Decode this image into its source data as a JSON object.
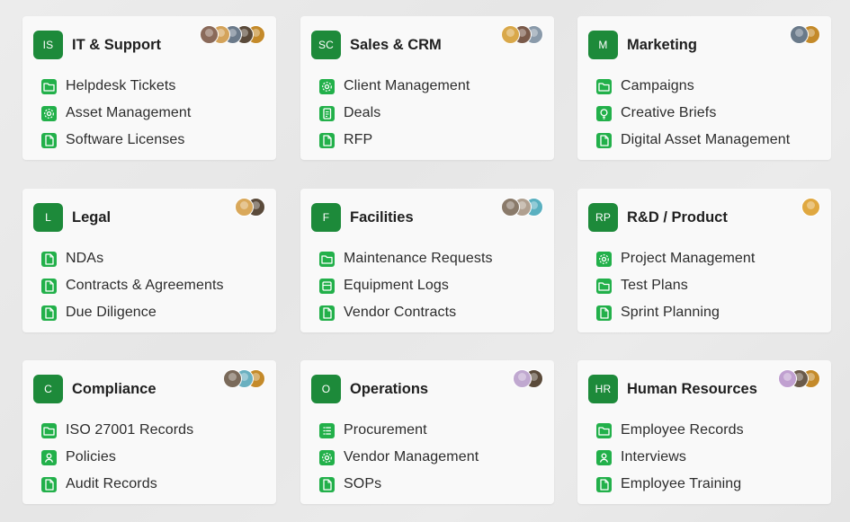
{
  "colors": {
    "badge": "#1d8a3a",
    "item_icon": "#22b04a",
    "card": "#f9f9f9"
  },
  "cards": [
    {
      "badge": "IS",
      "title": "IT & Support",
      "avatars": [
        "#8a6a5a",
        "#d4a35a",
        "#6b7a8a",
        "#5a4a3a",
        "#c48a2a"
      ],
      "items": [
        {
          "label": "Helpdesk Tickets",
          "icon": "folder-icon"
        },
        {
          "label": "Asset Management",
          "icon": "gear-icon"
        },
        {
          "label": "Software Licenses",
          "icon": "file-icon"
        }
      ]
    },
    {
      "badge": "SC",
      "title": "Sales & CRM",
      "avatars": [
        "#d9a84a",
        "#7a5a4a",
        "#8a9aaa"
      ],
      "items": [
        {
          "label": "Client Management",
          "icon": "gear-icon"
        },
        {
          "label": "Deals",
          "icon": "document-icon"
        },
        {
          "label": "RFP",
          "icon": "file-icon"
        }
      ]
    },
    {
      "badge": "M",
      "title": "Marketing",
      "avatars": [
        "#6a7a8a",
        "#c48a2a"
      ],
      "items": [
        {
          "label": "Campaigns",
          "icon": "folder-icon"
        },
        {
          "label": "Creative Briefs",
          "icon": "lightbulb-icon"
        },
        {
          "label": "Digital Asset Management",
          "icon": "file-icon"
        }
      ]
    },
    {
      "badge": "L",
      "title": "Legal",
      "avatars": [
        "#d9a85a",
        "#5a4a3a"
      ],
      "items": [
        {
          "label": "NDAs",
          "icon": "file-icon"
        },
        {
          "label": "Contracts & Agreements",
          "icon": "file-icon"
        },
        {
          "label": "Due Diligence",
          "icon": "file-icon"
        }
      ]
    },
    {
      "badge": "F",
      "title": "Facilities",
      "avatars": [
        "#8a7a6a",
        "#b0a090",
        "#5ab0c0"
      ],
      "items": [
        {
          "label": "Maintenance Requests",
          "icon": "folder-icon"
        },
        {
          "label": "Equipment Logs",
          "icon": "log-icon"
        },
        {
          "label": "Vendor Contracts",
          "icon": "file-icon"
        }
      ]
    },
    {
      "badge": "RP",
      "title": "R&D / Product",
      "avatars": [
        "#e0a840"
      ],
      "items": [
        {
          "label": "Project Management",
          "icon": "gear-icon"
        },
        {
          "label": "Test Plans",
          "icon": "folder-icon"
        },
        {
          "label": "Sprint Planning",
          "icon": "file-icon"
        }
      ]
    },
    {
      "badge": "C",
      "title": "Compliance",
      "avatars": [
        "#7a6a5a",
        "#6ab0c0",
        "#c48a2a"
      ],
      "items": [
        {
          "label": "ISO 27001 Records",
          "icon": "folder-icon"
        },
        {
          "label": "Policies",
          "icon": "user-icon"
        },
        {
          "label": "Audit Records",
          "icon": "file-icon"
        }
      ]
    },
    {
      "badge": "O",
      "title": "Operations",
      "avatars": [
        "#c0a8d0",
        "#5a4a3a"
      ],
      "items": [
        {
          "label": "Procurement",
          "icon": "list-icon"
        },
        {
          "label": "Vendor Management",
          "icon": "gear-icon"
        },
        {
          "label": "SOPs",
          "icon": "file-icon"
        }
      ]
    },
    {
      "badge": "HR",
      "title": "Human Resources",
      "avatars": [
        "#c0a0d0",
        "#6a5a4a",
        "#c48a2a"
      ],
      "items": [
        {
          "label": "Employee Records",
          "icon": "folder-icon"
        },
        {
          "label": "Interviews",
          "icon": "user-icon"
        },
        {
          "label": "Employee Training",
          "icon": "file-icon"
        }
      ]
    }
  ]
}
